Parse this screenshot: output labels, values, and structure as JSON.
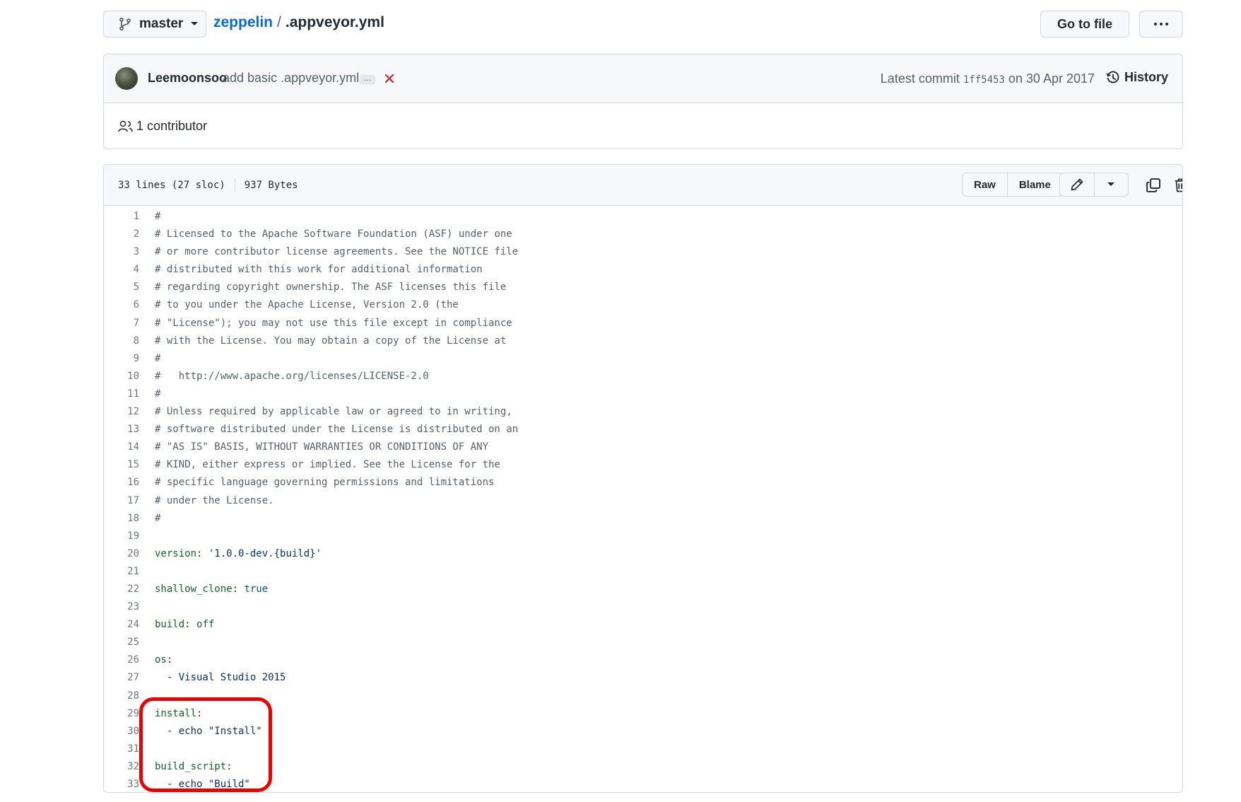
{
  "topbar": {
    "branch": "master",
    "repo": "zeppelin",
    "separator": "/",
    "file": ".appveyor.yml",
    "goto_label": "Go to file",
    "more_label": "···"
  },
  "commit": {
    "author": "Leemoonsoo",
    "message": "add basic .appveyor.yml",
    "ellipsis": "…",
    "latest_prefix": "Latest commit",
    "sha": "1ff5453",
    "date_text": "on 30 Apr 2017",
    "history_label": "History",
    "contributors": "1 contributor"
  },
  "file": {
    "lines_info": "33 lines (27 sloc)",
    "size": "937 Bytes",
    "raw_label": "Raw",
    "blame_label": "Blame"
  },
  "code": [
    [
      {
        "t": "#",
        "c": "com"
      }
    ],
    [
      {
        "t": "# Licensed to the Apache Software Foundation (ASF) under one",
        "c": "com"
      }
    ],
    [
      {
        "t": "# or more contributor license agreements. See the NOTICE file",
        "c": "com"
      }
    ],
    [
      {
        "t": "# distributed with this work for additional information",
        "c": "com"
      }
    ],
    [
      {
        "t": "# regarding copyright ownership. The ASF licenses this file",
        "c": "com"
      }
    ],
    [
      {
        "t": "# to you under the Apache License, Version 2.0 (the",
        "c": "com"
      }
    ],
    [
      {
        "t": "# \"License\"); you may not use this file except in compliance",
        "c": "com"
      }
    ],
    [
      {
        "t": "# with the License. You may obtain a copy of the License at",
        "c": "com"
      }
    ],
    [
      {
        "t": "#",
        "c": "com"
      }
    ],
    [
      {
        "t": "#   http://www.apache.org/licenses/LICENSE-2.0",
        "c": "com"
      }
    ],
    [
      {
        "t": "#",
        "c": "com"
      }
    ],
    [
      {
        "t": "# Unless required by applicable law or agreed to in writing,",
        "c": "com"
      }
    ],
    [
      {
        "t": "# software distributed under the License is distributed on an",
        "c": "com"
      }
    ],
    [
      {
        "t": "# \"AS IS\" BASIS, WITHOUT WARRANTIES OR CONDITIONS OF ANY",
        "c": "com"
      }
    ],
    [
      {
        "t": "# KIND, either express or implied. See the License for the",
        "c": "com"
      }
    ],
    [
      {
        "t": "# specific language governing permissions and limitations",
        "c": "com"
      }
    ],
    [
      {
        "t": "# under the License.",
        "c": "com"
      }
    ],
    [
      {
        "t": "#",
        "c": "com"
      }
    ],
    [],
    [
      {
        "t": "version",
        "c": "key"
      },
      {
        "t": ": ",
        "c": ""
      },
      {
        "t": "'1.0.0-dev.{build}'",
        "c": "str"
      }
    ],
    [],
    [
      {
        "t": "shallow_clone",
        "c": "key"
      },
      {
        "t": ": ",
        "c": ""
      },
      {
        "t": "true",
        "c": "bool"
      }
    ],
    [],
    [
      {
        "t": "build",
        "c": "key"
      },
      {
        "t": ": ",
        "c": ""
      },
      {
        "t": "off",
        "c": "key"
      }
    ],
    [],
    [
      {
        "t": "os",
        "c": "key"
      },
      {
        "t": ":",
        "c": ""
      }
    ],
    [
      {
        "t": "  - ",
        "c": ""
      },
      {
        "t": "Visual Studio 2015",
        "c": "str"
      }
    ],
    [],
    [
      {
        "t": "install",
        "c": "key"
      },
      {
        "t": ":",
        "c": ""
      }
    ],
    [
      {
        "t": "  - ",
        "c": ""
      },
      {
        "t": "echo \"Install\"",
        "c": "str"
      }
    ],
    [],
    [
      {
        "t": "build_script",
        "c": "key"
      },
      {
        "t": ":",
        "c": ""
      }
    ],
    [
      {
        "t": "  - ",
        "c": ""
      },
      {
        "t": "echo \"Build\"",
        "c": "str"
      }
    ]
  ],
  "colors": {
    "link": "#0969da",
    "annotation": "#ee0000",
    "yaml_key": "#116329",
    "yaml_string": "#0a3069",
    "comment": "#57606a"
  }
}
